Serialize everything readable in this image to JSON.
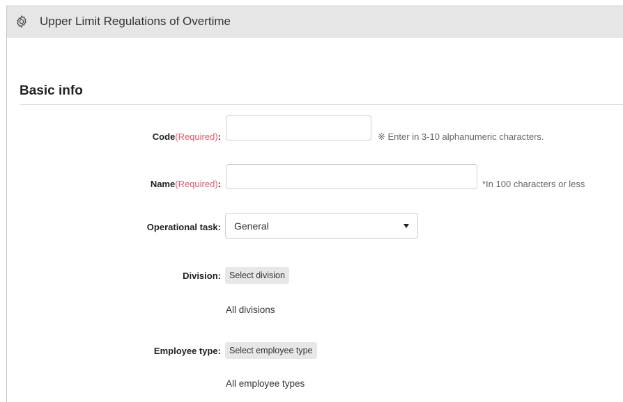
{
  "header": {
    "title": "Upper Limit Regulations of Overtime",
    "icon": "gear-icon"
  },
  "section": {
    "title": "Basic info"
  },
  "fields": {
    "code": {
      "label": "Code",
      "required": "(Required)",
      "colon": ":",
      "value": "",
      "hint": "※ Enter in 3-10 alphanumeric characters."
    },
    "name": {
      "label": "Name",
      "required": "(Required)",
      "colon": ":",
      "value": "",
      "hint": "*In 100 characters or less"
    },
    "operational_task": {
      "label": "Operational task:",
      "selected": "General"
    },
    "division": {
      "label": "Division:",
      "button": "Select division",
      "value": "All divisions"
    },
    "employee_type": {
      "label": "Employee type:",
      "button": "Select employee type",
      "value": "All employee types"
    }
  },
  "colors": {
    "required": "#e0556b",
    "header_bg": "#e6e6e6"
  }
}
